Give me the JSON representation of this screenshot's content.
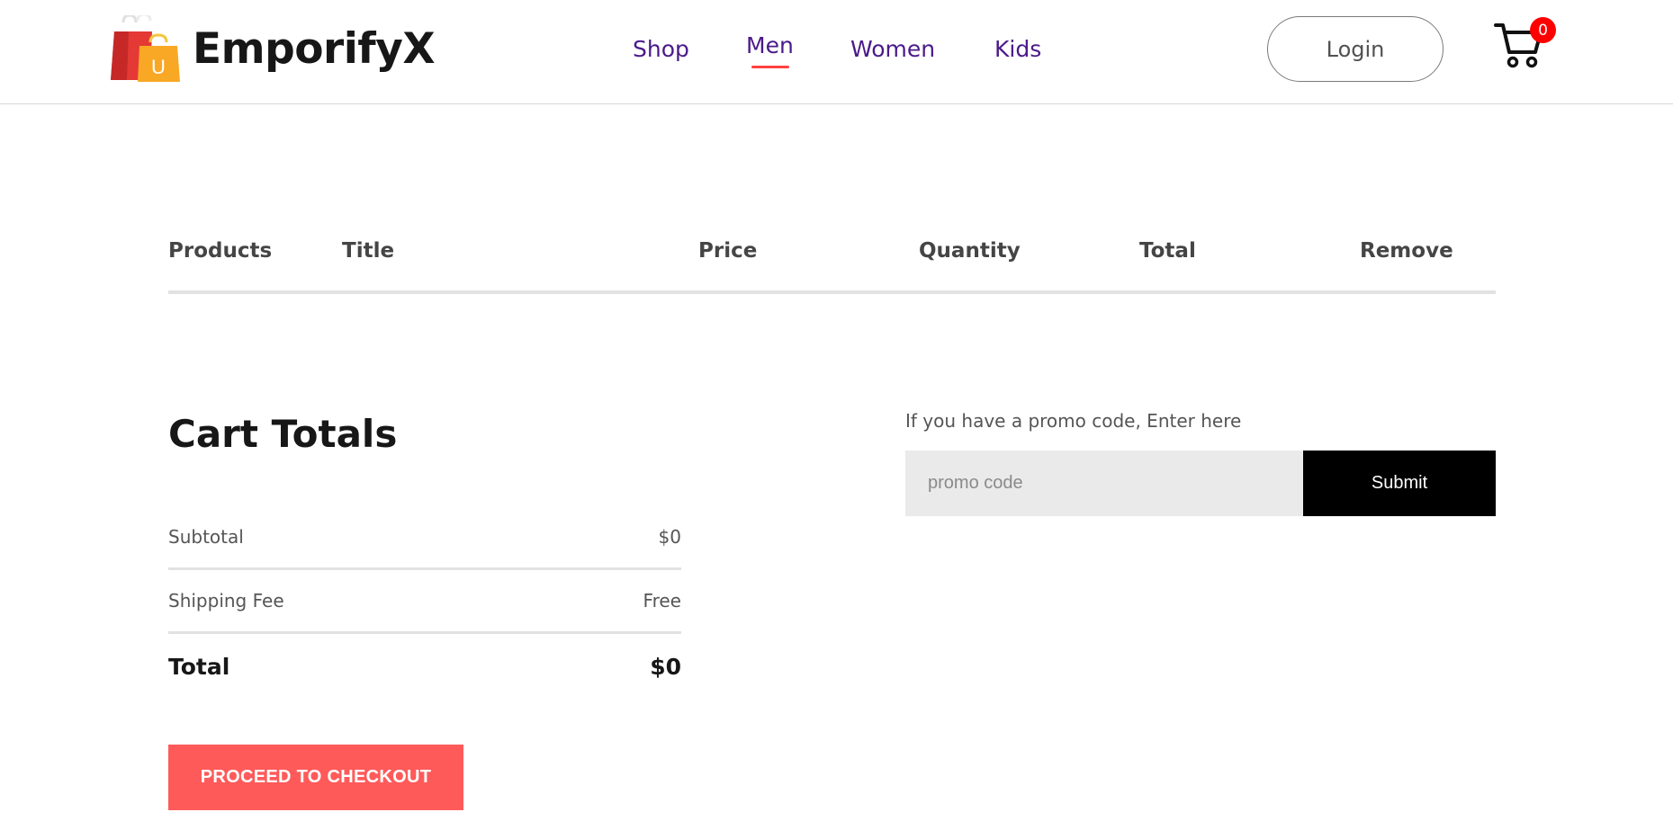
{
  "navbar": {
    "logo_letter": "U",
    "brand": "EmporifyX",
    "menu": {
      "shop": "Shop",
      "men": "Men",
      "women": "Women",
      "kids": "Kids"
    },
    "active_item": "Men",
    "login_label": "Login",
    "cart_count": "0",
    "colors": {
      "menu_text": "#4b1a8a",
      "active_underline": "#ff4141",
      "cart_badge": "#ff0000"
    }
  },
  "cart_table": {
    "headers": [
      "Products",
      "Title",
      "Price",
      "Quantity",
      "Total",
      "Remove"
    ],
    "rows": []
  },
  "cart_totals": {
    "title": "Cart Totals",
    "subtotal_label": "Subtotal",
    "subtotal_value": "$0",
    "shipping_label": "Shipping Fee",
    "shipping_value": "Free",
    "total_label": "Total",
    "total_value": "$0",
    "checkout_label": "PROCEED TO CHECKOUT",
    "checkout_color": "#ff5a5a"
  },
  "promo": {
    "label": "If you have a promo code, Enter here",
    "placeholder": "promo code",
    "value": "",
    "submit_label": "Submit"
  },
  "icons": {
    "logo": "shopping-bag-icon",
    "cart": "cart-icon"
  }
}
